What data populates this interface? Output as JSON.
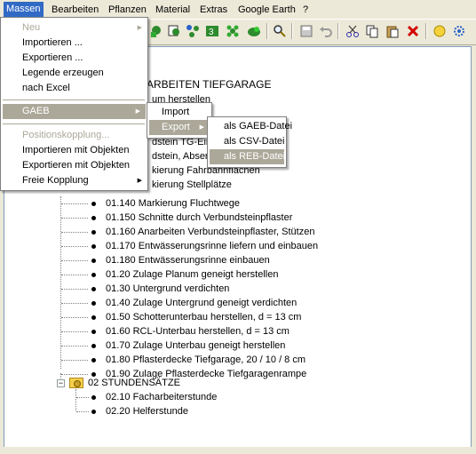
{
  "menubar": {
    "items": [
      "Massen",
      "Bearbeiten",
      "Pflanzen",
      "Material",
      "Extras",
      "Google Earth",
      "?"
    ]
  },
  "toolbar": {
    "icons": [
      "tree-add-icon",
      "copy-tree-icon",
      "network-icon",
      "calc3-icon",
      "flower-icon",
      "shrub-icon",
      "magnify-icon",
      "save-icon",
      "undo-icon",
      "cut-icon",
      "copy-icon",
      "paste-icon",
      "delete-icon",
      "circle-icon",
      "gear-icon"
    ]
  },
  "massen_menu": {
    "items": [
      {
        "label": "Neu",
        "disabled": true,
        "submenu": true
      },
      {
        "label": "Importieren ..."
      },
      {
        "label": "Exportieren ..."
      },
      {
        "label": "Legende erzeugen"
      },
      {
        "label": "nach Excel"
      },
      {
        "label": "GAEB",
        "submenu": true,
        "highlighted": true
      },
      {
        "label": "Positionskopplung...",
        "disabled": true
      },
      {
        "label": "Importieren mit Objekten"
      },
      {
        "label": "Exportieren mit Objekten"
      },
      {
        "label": "Freie Kopplung",
        "submenu": true
      }
    ]
  },
  "gaeb_menu": {
    "items": [
      {
        "label": "Import"
      },
      {
        "label": "Export",
        "submenu": true,
        "highlighted": true
      }
    ]
  },
  "export_menu": {
    "items": [
      {
        "label": "als GAEB-Datei"
      },
      {
        "label": "als CSV-Datei"
      },
      {
        "label": "als REB-Datei",
        "highlighted": true
      }
    ]
  },
  "tree": {
    "partial_rows": [
      "ARBEITEN TIEFGARAGE",
      "um herstellen",
      "dstein TG-Ein",
      "dstein, Abser",
      "kierung Fahrbahnflächen",
      "kierung Stellplätze"
    ],
    "group1_items": [
      "01.140 Markierung Fluchtwege",
      "01.150 Schnitte durch Verbundsteinpflaster",
      "01.160 Anarbeiten Verbundsteinpflaster, Stützen",
      "01.170 Entwässerungsrinne liefern und einbauen",
      "01.180 Entwässerungsrinne einbauen",
      "01.20 Zulage Planum geneigt herstellen",
      "01.30 Untergrund verdichten",
      "01.40 Zulage Untergrund geneigt verdichten",
      "01.50 Schotterunterbau herstellen, d = 13 cm",
      "01.60 RCL-Unterbau herstellen, d = 13 cm",
      "01.70 Zulage Unterbau geneigt herstellen",
      "01.80 Pflasterdecke Tiefgarage, 20 / 10 / 8 cm",
      "01.90 Zulage Pflasterdecke Tiefgaragenrampe"
    ],
    "group2": {
      "label": "02 STUNDENSÄTZE",
      "items": [
        "02.10 Facharbeiterstunde",
        "02.20 Helferstunde"
      ]
    }
  }
}
